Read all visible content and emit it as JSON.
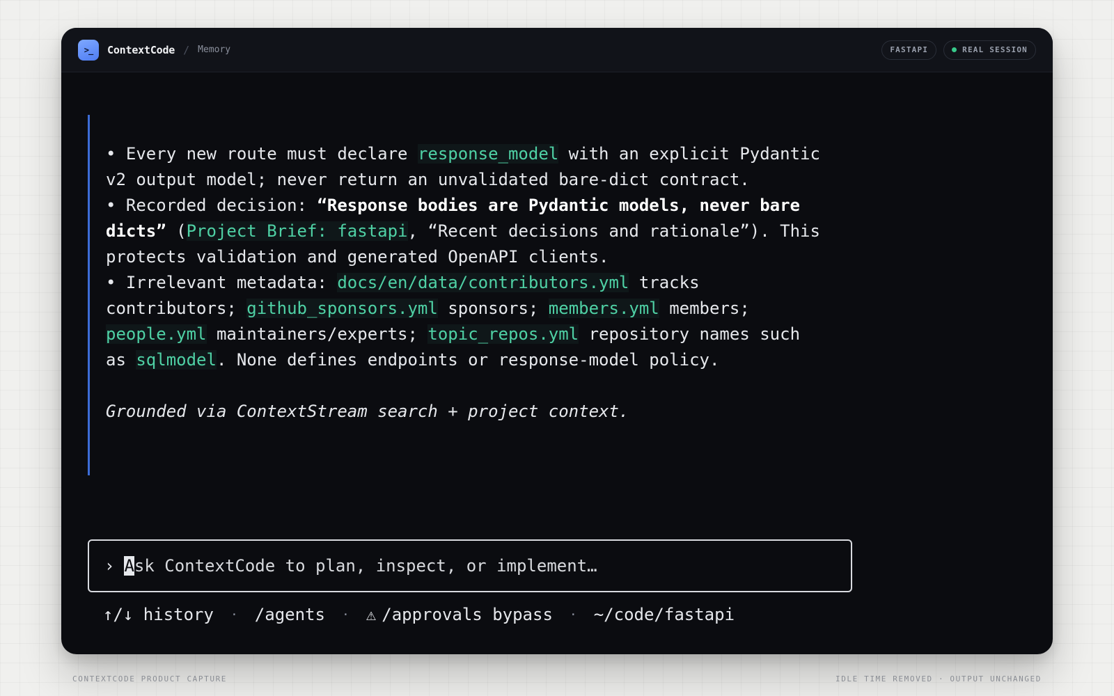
{
  "header": {
    "app_icon_glyph": ">_",
    "app_name": "ContextCode",
    "separator": "/",
    "breadcrumb": "Memory",
    "badges": {
      "project": "FASTAPI",
      "session": "REAL SESSION"
    },
    "session_status_color": "#38c98a"
  },
  "transcript": {
    "bullet1": {
      "a": "• Every new route must declare ",
      "code1": "response_model",
      "b": " with an explicit Pydantic v2 output model; never return an unvalidated bare-dict contract."
    },
    "bullet2": {
      "a": "• Recorded decision: ",
      "strong": "“Response bodies are Pydantic models, never bare dicts”",
      "b": " (",
      "code1": "Project Brief: fastapi",
      "c": ", “Recent decisions and rationale”). This protects validation and generated OpenAPI clients."
    },
    "bullet3": {
      "a": "• Irrelevant metadata: ",
      "code1": "docs/en/data/contributors.yml",
      "b": " tracks contributors; ",
      "code2": "github_sponsors.yml",
      "c": " sponsors; ",
      "code3": "members.yml",
      "d": " members; ",
      "code4": "people.yml",
      "e": " maintainers/experts; ",
      "code5": "topic_repos.yml",
      "f": " repository names such as ",
      "code6": "sqlmodel",
      "g": ". None defines endpoints or response-model policy."
    },
    "grounded": "Grounded via ContextStream search + project context."
  },
  "prompt": {
    "chevron": "›",
    "cursor_char": "A",
    "placeholder_rest": "sk ContextCode to plan, inspect, or implement…"
  },
  "status_bar": {
    "history": "↑/↓ history",
    "separator": "·",
    "agents": "/agents",
    "warning_glyph": "⚠",
    "approvals": "/approvals bypass",
    "cwd": "~/code/fastapi"
  },
  "footer": {
    "left": "CONTEXTCODE PRODUCT CAPTURE",
    "right": "IDLE TIME REMOVED · OUTPUT UNCHANGED"
  },
  "colors": {
    "accent_border": "#3d6cd6",
    "code_text": "#4fd1a5",
    "window_bg": "#0b0c10"
  }
}
